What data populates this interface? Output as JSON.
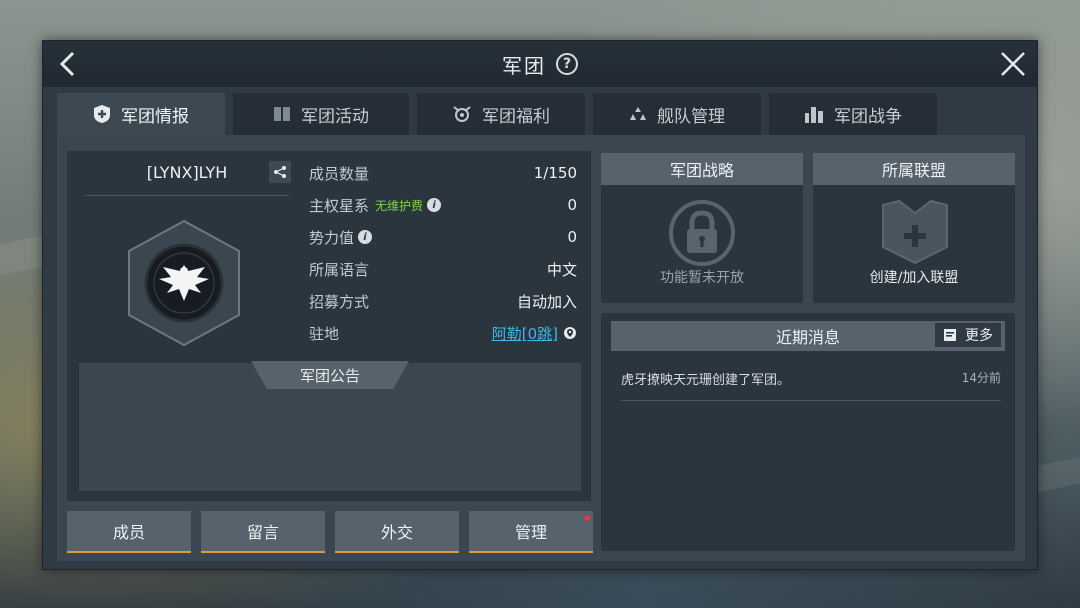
{
  "window": {
    "title": "军团"
  },
  "tabs": [
    {
      "label": "军团情报",
      "icon": "shield-plus-icon",
      "active": true
    },
    {
      "label": "军团活动",
      "icon": "book-icon",
      "active": false
    },
    {
      "label": "军团福利",
      "icon": "gift-icon",
      "active": false
    },
    {
      "label": "舰队管理",
      "icon": "fleet-icon",
      "active": false
    },
    {
      "label": "军团战争",
      "icon": "city-icon",
      "active": false
    }
  ],
  "guild": {
    "name": "[LYNX]LYH",
    "stats": [
      {
        "label": "成员数量",
        "value": "1/150"
      },
      {
        "label": "主权星系",
        "tag": "无维护费",
        "value": "0"
      },
      {
        "label": "势力值",
        "value": "0"
      },
      {
        "label": "所属语言",
        "value": "中文"
      },
      {
        "label": "招募方式",
        "value": "自动加入"
      },
      {
        "label": "驻地",
        "value": "阿勒[0跳]"
      }
    ],
    "notice_title": "军团公告"
  },
  "buttons": [
    "成员",
    "留言",
    "外交",
    "管理"
  ],
  "strategy": {
    "title": "军团战略",
    "text": "功能暂未开放"
  },
  "alliance": {
    "title": "所属联盟",
    "text": "创建/加入联盟"
  },
  "news": {
    "title": "近期消息",
    "more": "更多",
    "items": [
      {
        "text": "虎牙撩映天元珊创建了军团。",
        "time": "14分前"
      }
    ]
  },
  "colors": {
    "accent_orange": "#d89a3a",
    "green_tag": "#79d24a",
    "link_blue": "#3fb7e6",
    "red_dot": "#e23b3b"
  }
}
